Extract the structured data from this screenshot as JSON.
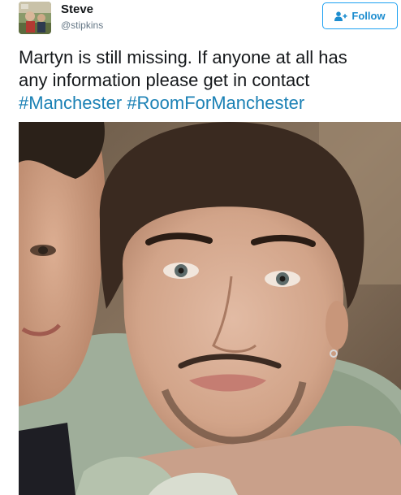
{
  "author": {
    "display_name": "Steve",
    "handle": "@stipkins"
  },
  "follow_button": {
    "label": "Follow"
  },
  "tweet": {
    "text_line_1": "Martyn is still missing. If anyone at all has",
    "text_line_2": "any information please get in contact",
    "hashtags": [
      "#Manchester",
      "#RoomForManchester"
    ]
  },
  "colors": {
    "link": "#1b81b5",
    "follow_border": "#1da1f2",
    "text": "#14171a",
    "handle": "#657786"
  },
  "icons": {
    "follow": "add-user-icon"
  }
}
